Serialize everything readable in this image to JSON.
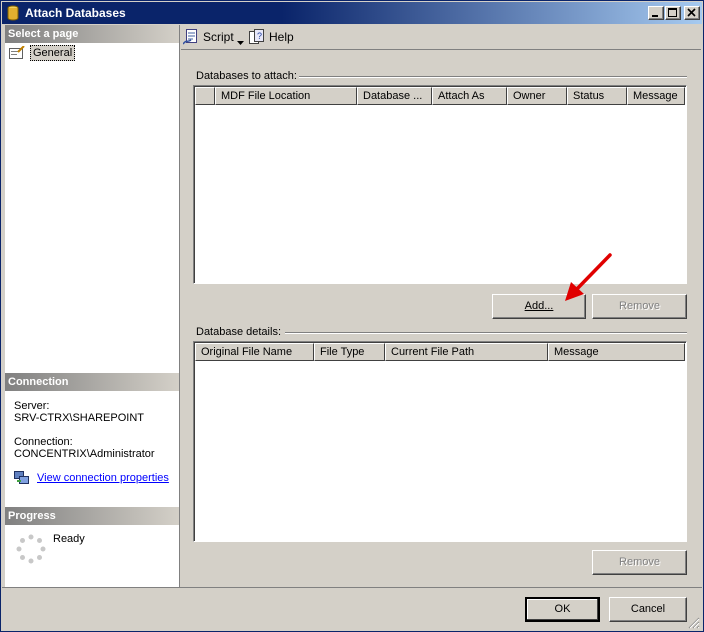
{
  "window": {
    "title": "Attach Databases"
  },
  "left": {
    "select_header": "Select a page",
    "pages": [
      {
        "label": "General"
      }
    ],
    "connection_header": "Connection",
    "server_label": "Server:",
    "server_value": "SRV-CTRX\\SHAREPOINT",
    "connection_label": "Connection:",
    "connection_value": "CONCENTRIX\\Administrator",
    "view_link": "View connection properties",
    "progress_header": "Progress",
    "progress_status": "Ready"
  },
  "toolbar": {
    "script_label": "Script",
    "help_label": "Help"
  },
  "attach": {
    "label": "Databases to attach:",
    "columns": [
      "",
      "MDF File Location",
      "Database ...",
      "Attach As",
      "Owner",
      "Status",
      "Message"
    ],
    "add_button": "Add...",
    "remove_button": "Remove"
  },
  "details": {
    "label": "Database details:",
    "columns": [
      "Original File Name",
      "File Type",
      "Current File Path",
      "Message"
    ],
    "remove_button": "Remove"
  },
  "footer": {
    "ok_button": "OK",
    "cancel_button": "Cancel"
  },
  "colors": {
    "title_bar": "#0a246a",
    "arrow": "#e00000",
    "link": "#0000ff"
  }
}
